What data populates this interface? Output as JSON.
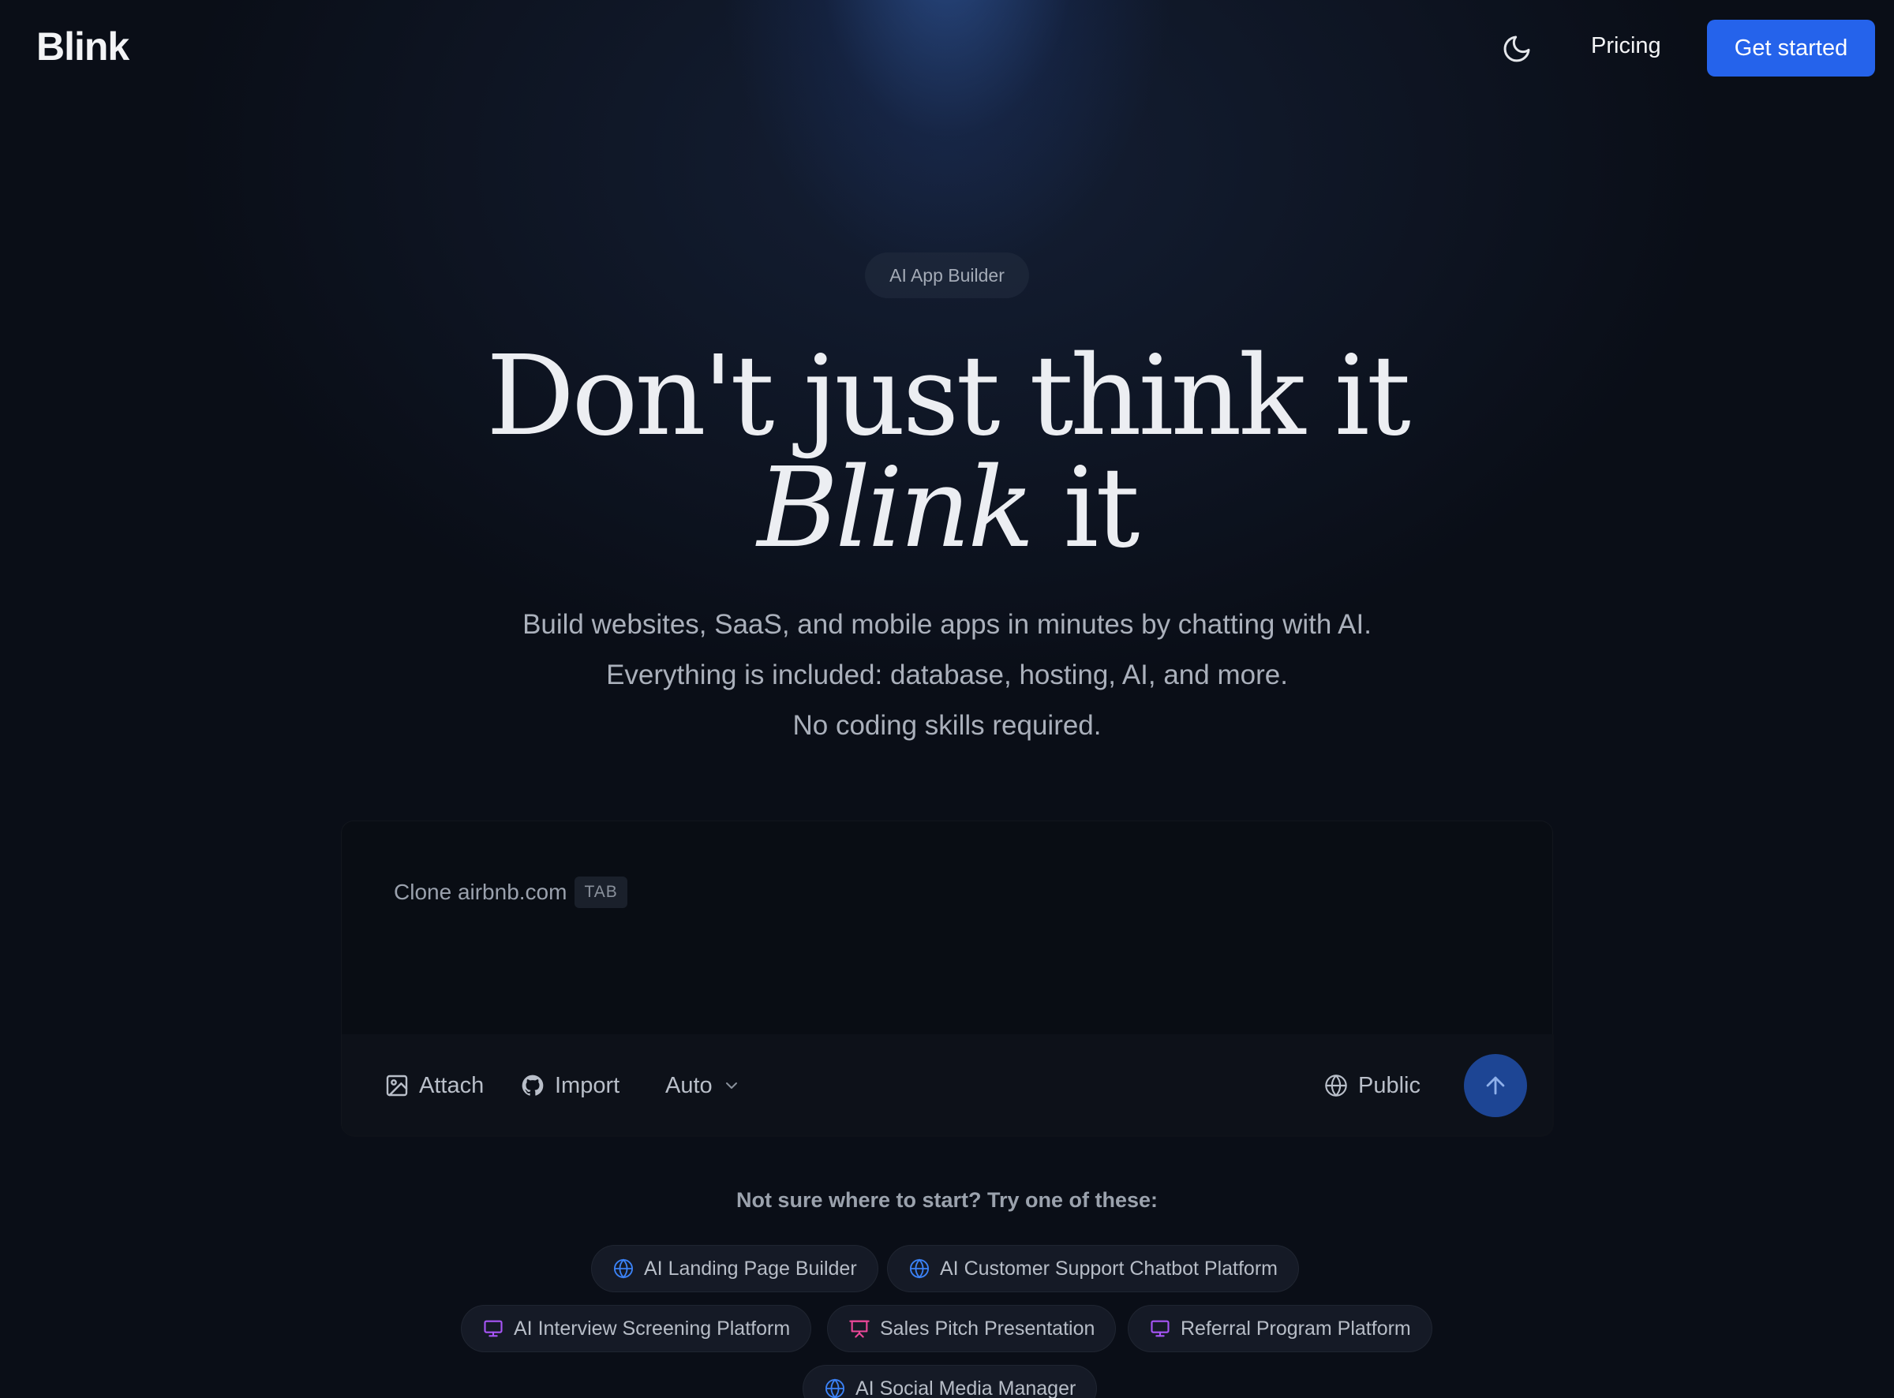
{
  "header": {
    "logo": "Blink",
    "pricing_label": "Pricing",
    "cta_label": "Get started"
  },
  "hero": {
    "badge": "AI App Builder",
    "headline_line1": "Don't just think it",
    "headline_italic": "Blink",
    "headline_line2_rest": " it",
    "subtitle_lines": [
      "Build websites, SaaS, and mobile apps in minutes by chatting with AI.",
      "Everything is included: database, hosting, AI, and more.",
      "No coding skills required."
    ]
  },
  "prompt": {
    "placeholder": "Clone airbnb.com",
    "tab_hint": "TAB",
    "attach_label": "Attach",
    "import_label": "Import",
    "mode_label": "Auto",
    "visibility_label": "Public"
  },
  "suggestions": {
    "title": "Not sure where to start? Try one of these:",
    "chips": [
      {
        "label": "AI Landing Page Builder",
        "icon": "globe-icon",
        "color": "#3b82f6"
      },
      {
        "label": "AI Customer Support Chatbot Platform",
        "icon": "globe-icon",
        "color": "#3b82f6"
      },
      {
        "label": "AI Interview Screening Platform",
        "icon": "monitor-icon",
        "color": "#a855f7"
      },
      {
        "label": "Sales Pitch Presentation",
        "icon": "presentation-icon",
        "color": "#ec4899"
      },
      {
        "label": "Referral Program Platform",
        "icon": "monitor-icon",
        "color": "#a855f7"
      },
      {
        "label": "AI Social Media Manager",
        "icon": "globe-icon",
        "color": "#3b82f6"
      }
    ]
  },
  "colors": {
    "accent": "#2563eb",
    "send_button": "#1d4594",
    "background": "#0a0e17"
  }
}
